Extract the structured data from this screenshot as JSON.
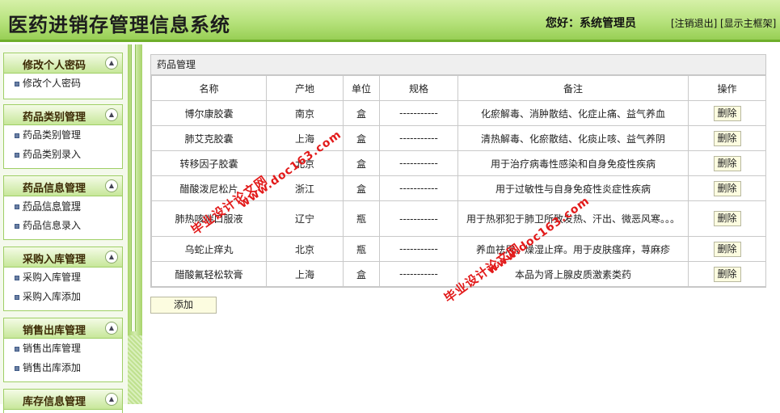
{
  "header": {
    "title": "医药进销存管理信息系统",
    "greeting": "您好：系统管理员",
    "logout_link": "[注销退出]",
    "show_frame_link": "[显示主框架]"
  },
  "sidebar": {
    "menus": [
      {
        "title": "修改个人密码",
        "items": [
          "修改个人密码"
        ]
      },
      {
        "title": "药品类别管理",
        "items": [
          "药品类别管理",
          "药品类别录入"
        ]
      },
      {
        "title": "药品信息管理",
        "items": [
          "药品信息管理",
          "药品信息录入"
        ]
      },
      {
        "title": "采购入库管理",
        "items": [
          "采购入库管理",
          "采购入库添加"
        ]
      },
      {
        "title": "销售出库管理",
        "items": [
          "销售出库管理",
          "销售出库添加"
        ]
      },
      {
        "title": "库存信息管理",
        "items": []
      }
    ]
  },
  "main": {
    "panel_title": "药品管理",
    "columns": [
      "名称",
      "产地",
      "单位",
      "规格",
      "备注",
      "操作"
    ],
    "rows": [
      {
        "name": "博尔康胶囊",
        "origin": "南京",
        "unit": "盒",
        "spec": "-----------",
        "note": "化瘀解毒、消肿散结、化症止痛、益气养血",
        "action": "删除"
      },
      {
        "name": "肺艾克胶囊",
        "origin": "上海",
        "unit": "盒",
        "spec": "-----------",
        "note": "清热解毒、化瘀散结、化痰止咳、益气养阴",
        "action": "删除"
      },
      {
        "name": "转移因子胶囊",
        "origin": "北京",
        "unit": "盒",
        "spec": "-----------",
        "note": "用于治疗病毒性感染和自身免疫性疾病",
        "action": "删除"
      },
      {
        "name": "醋酸泼尼松片",
        "origin": "浙江",
        "unit": "盒",
        "spec": "-----------",
        "note": "用于过敏性与自身免疫性炎症性疾病",
        "action": "删除"
      },
      {
        "name": "肺热咳喘口服液",
        "origin": "辽宁",
        "unit": "瓶",
        "spec": "-----------",
        "note": "用于热邪犯于肺卫所致发热、汗出、微恶风寒。。。",
        "action": "删除"
      },
      {
        "name": "乌蛇止痒丸",
        "origin": "北京",
        "unit": "瓶",
        "spec": "-----------",
        "note": "养血祛风，燥湿止痒。用于皮肤瘙痒，荨麻疹",
        "action": "删除"
      },
      {
        "name": "醋酸氟轻松软膏",
        "origin": "上海",
        "unit": "盒",
        "spec": "-----------",
        "note": "本品为肾上腺皮质激素类药",
        "action": "删除"
      }
    ],
    "add_button": "添加"
  },
  "watermarks": [
    "毕业设计论文网",
    "www.doc163.com"
  ],
  "colors": {
    "header_green": "#b6e27c",
    "border_green": "#6eae2a",
    "button_bg": "#fcfce0",
    "watermark_red": "#e21a1a"
  }
}
